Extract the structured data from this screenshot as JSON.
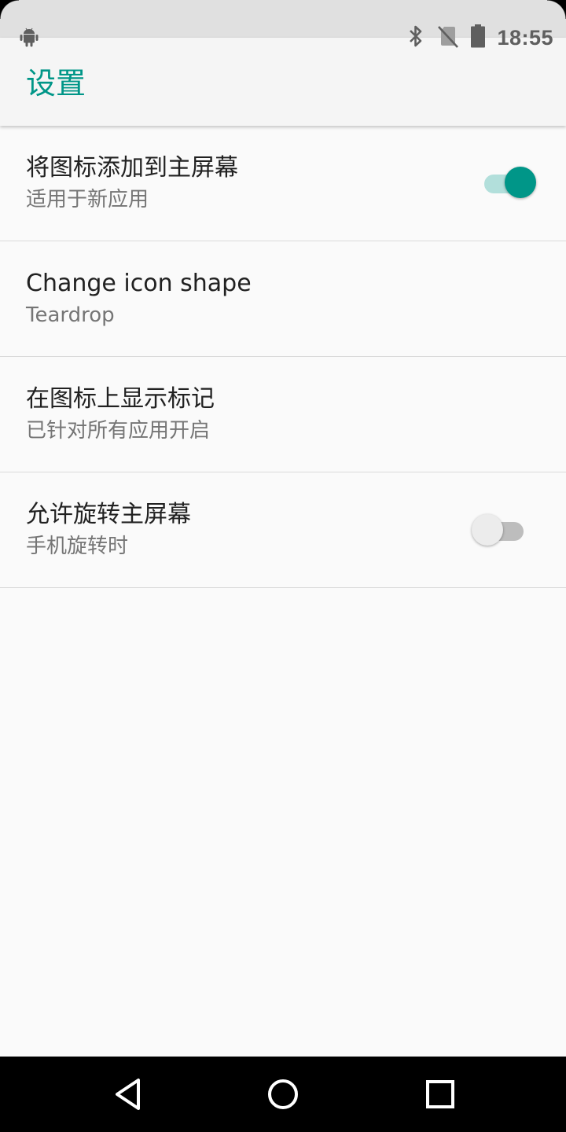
{
  "status_bar": {
    "time": "18:55",
    "icons": [
      "android-icon",
      "bluetooth-icon",
      "no-sim-icon",
      "battery-icon"
    ]
  },
  "app_bar": {
    "title": "设置"
  },
  "settings": [
    {
      "title": "将图标添加到主屏幕",
      "summary": "适用于新应用",
      "toggle": true
    },
    {
      "title": "Change icon shape",
      "summary": "Teardrop"
    },
    {
      "title": "在图标上显示标记",
      "summary": "已针对所有应用开启"
    },
    {
      "title": "允许旋转主屏幕",
      "summary": "手机旋转时",
      "toggle": false
    }
  ],
  "nav_bar": {
    "buttons": [
      "back-icon",
      "home-icon",
      "recents-icon"
    ]
  },
  "colors": {
    "accent": "#009688",
    "accent_light": "#b2dfdb",
    "background": "#fafafa",
    "app_bar": "#f5f5f5"
  }
}
